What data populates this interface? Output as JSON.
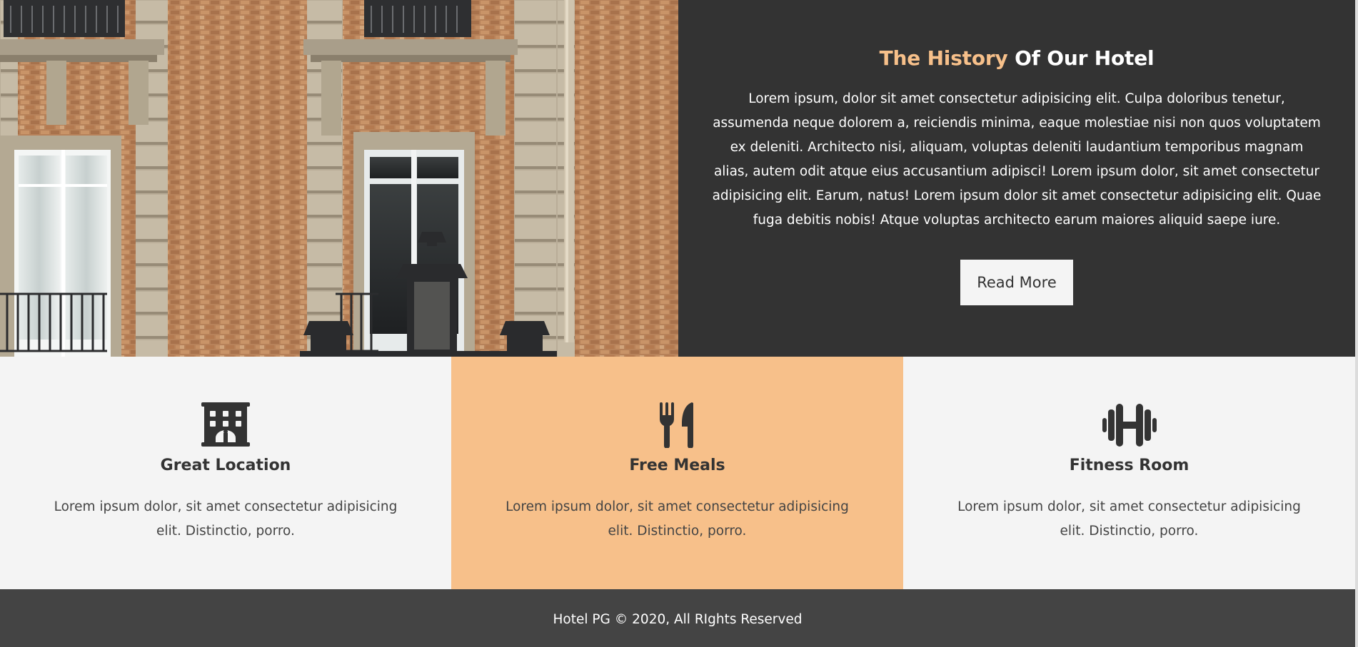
{
  "history": {
    "title_accent": "The History",
    "title_rest": "Of Our Hotel",
    "body": "Lorem ipsum, dolor sit amet consectetur adipisicing elit. Culpa doloribus tenetur, assumenda neque dolorem a, reiciendis minima, eaque molestiae nisi non quos voluptatem ex deleniti. Architecto nisi, aliquam, voluptas deleniti laudantium temporibus magnam alias, autem odit atque eius accusantium adipisci! Lorem ipsum dolor, sit amet consectetur adipisicing elit. Earum, natus! Lorem ipsum dolor sit amet consectetur adipisicing elit. Quae fuga debitis nobis! Atque voluptas architecto earum maiores aliquid saepe iure.",
    "button_label": "Read More",
    "accent_color": "#f7c08a",
    "background_color": "#333333"
  },
  "features": [
    {
      "icon": "hotel-building-icon",
      "title": "Great Location",
      "text": "Lorem ipsum dolor, sit amet consectetur adipisicing elit. Distinctio, porro."
    },
    {
      "icon": "utensils-icon",
      "title": "Free Meals",
      "text": "Lorem ipsum dolor, sit amet consectetur adipisicing elit. Distinctio, porro."
    },
    {
      "icon": "dumbbell-icon",
      "title": "Fitness Room",
      "text": "Lorem ipsum dolor, sit amet consectetur adipisicing elit. Distinctio, porro."
    }
  ],
  "colors": {
    "highlight_feature": "#f7c08a",
    "light_bg": "#f4f4f4",
    "dark": "#333333",
    "footer_bg": "#444444"
  },
  "footer": {
    "text": "Hotel PG © 2020, All RIghts Reserved"
  }
}
